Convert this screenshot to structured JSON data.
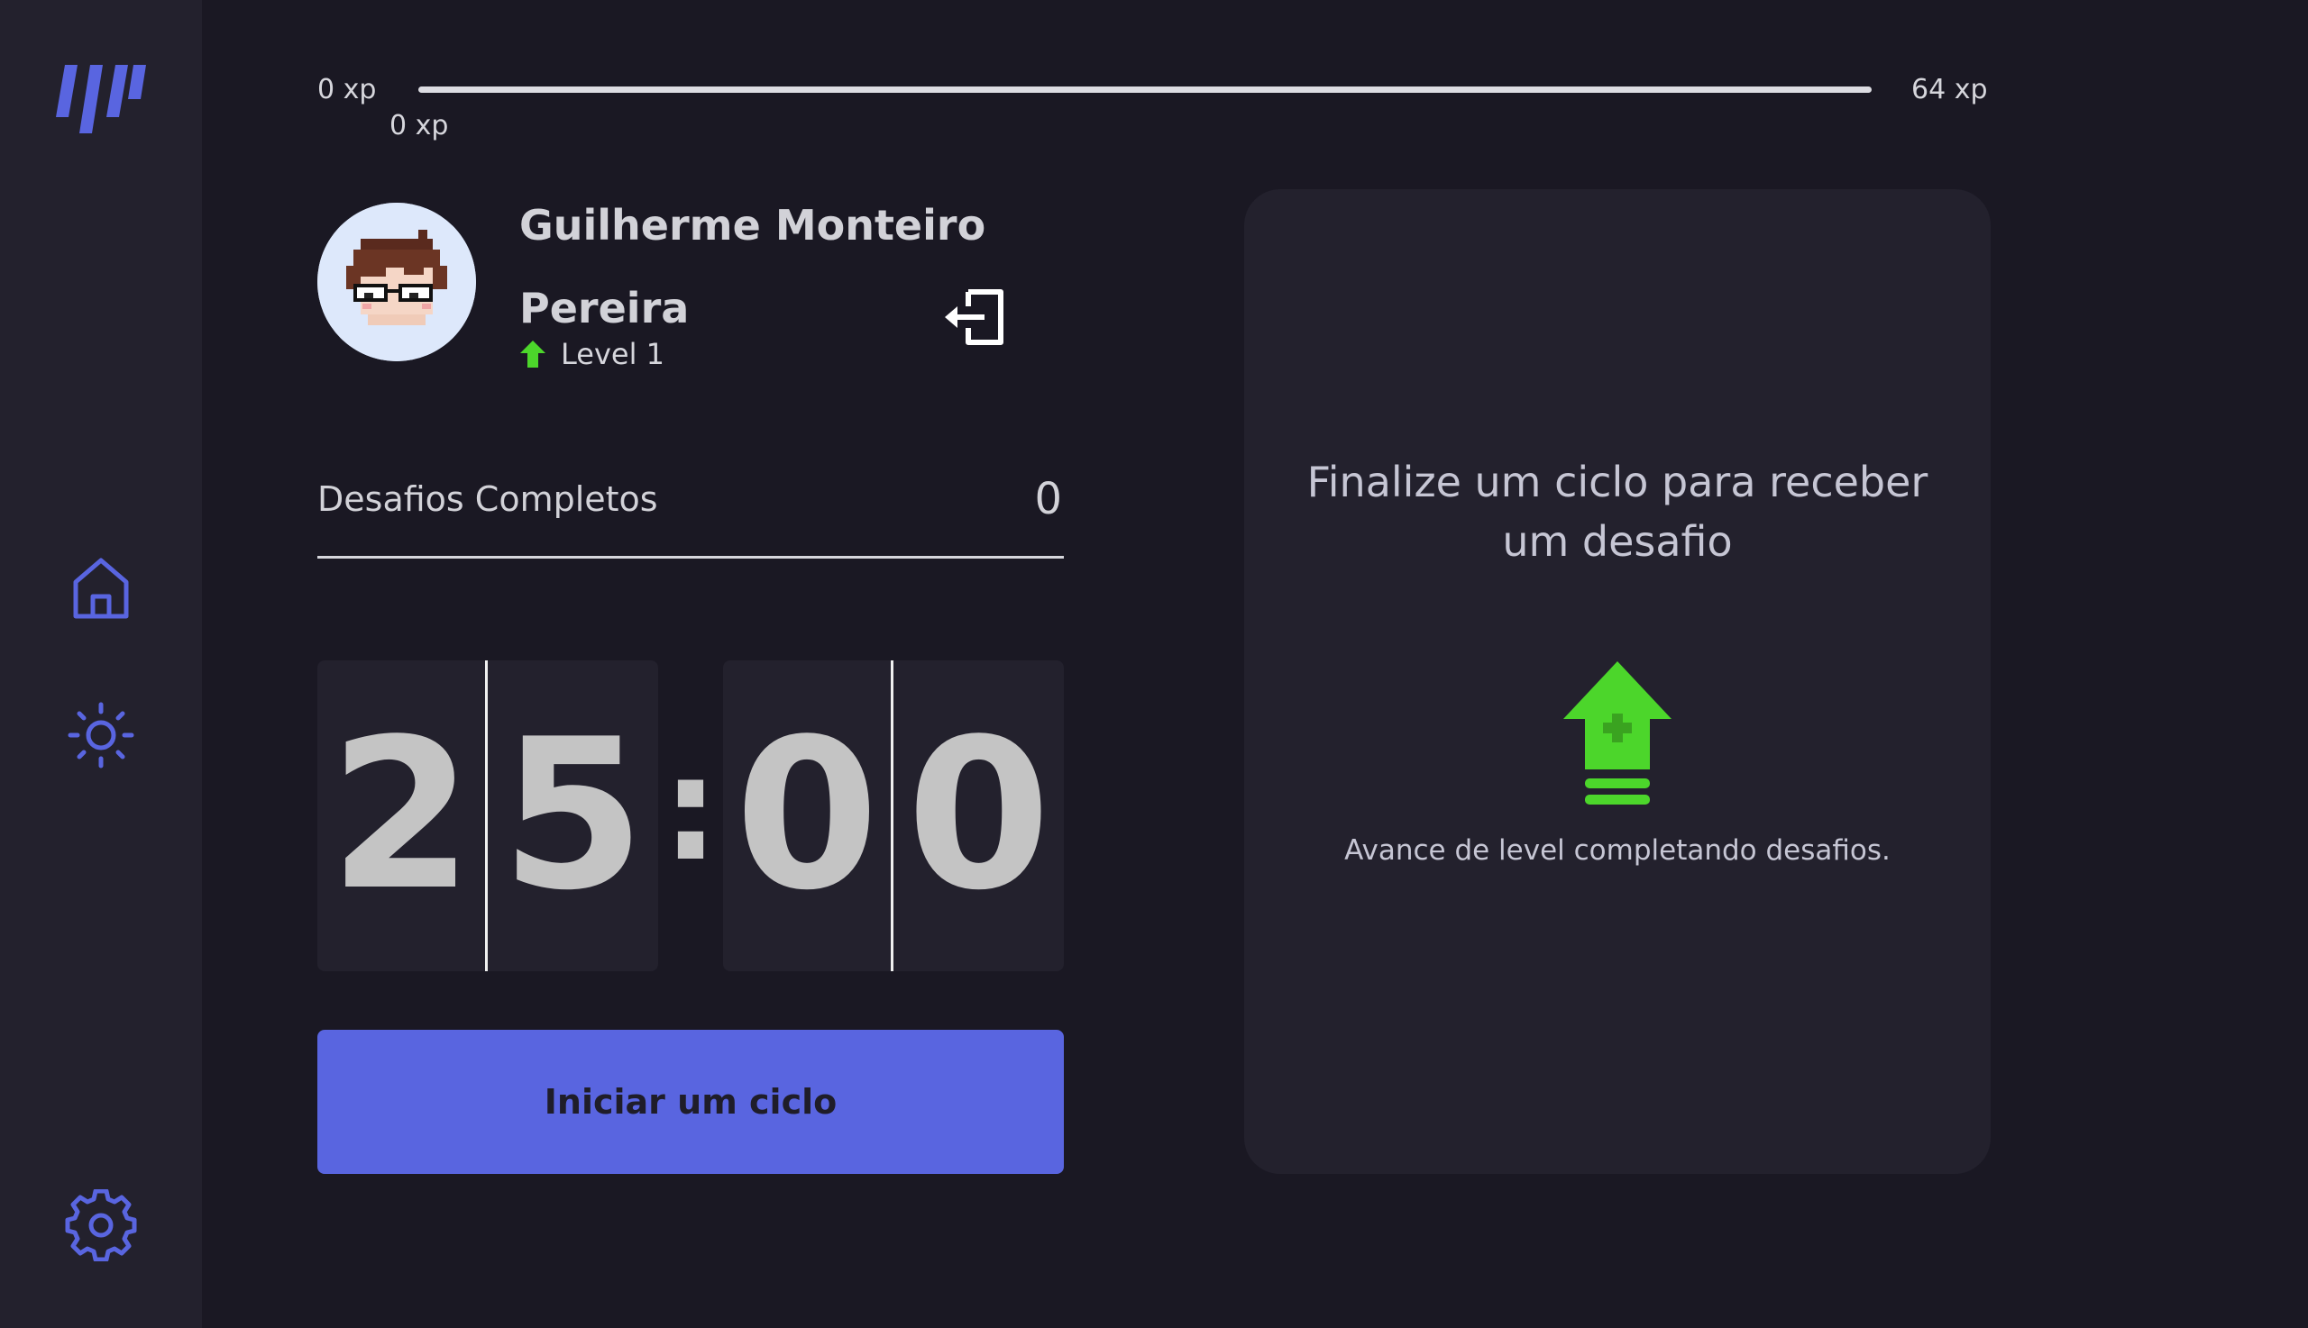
{
  "sidebar": {
    "logo": "moveit-logo",
    "items": [
      {
        "name": "home-icon",
        "active": true
      },
      {
        "name": "sun-icon",
        "active": false
      },
      {
        "name": "gear-icon",
        "active": false
      }
    ],
    "icon_color": "#5965e0"
  },
  "experience": {
    "start_label": "0 xp",
    "end_label": "64 xp",
    "current_label": "0 xp",
    "current_value": 0,
    "max_value": 64
  },
  "profile": {
    "name": "Guilherme Monteiro Pereira",
    "level_label": "Level 1",
    "level_icon": "level-up-arrow-icon",
    "logout_icon": "logout-icon"
  },
  "challenges": {
    "label": "Desafios Completos",
    "value": "0"
  },
  "countdown": {
    "minute_left": "2",
    "minute_right": "5",
    "separator": ":",
    "second_left": "0",
    "second_right": "0"
  },
  "start_button": {
    "label": "Iniciar um ciclo"
  },
  "challenge_card": {
    "title": "Finalize um ciclo para receber um desafio",
    "icon": "level-up-icon",
    "text": "Avance de level completando desafios."
  },
  "colors": {
    "background": "#1a1823",
    "panel": "#23212d",
    "accent": "#5965e0",
    "green": "#4cd62b"
  }
}
